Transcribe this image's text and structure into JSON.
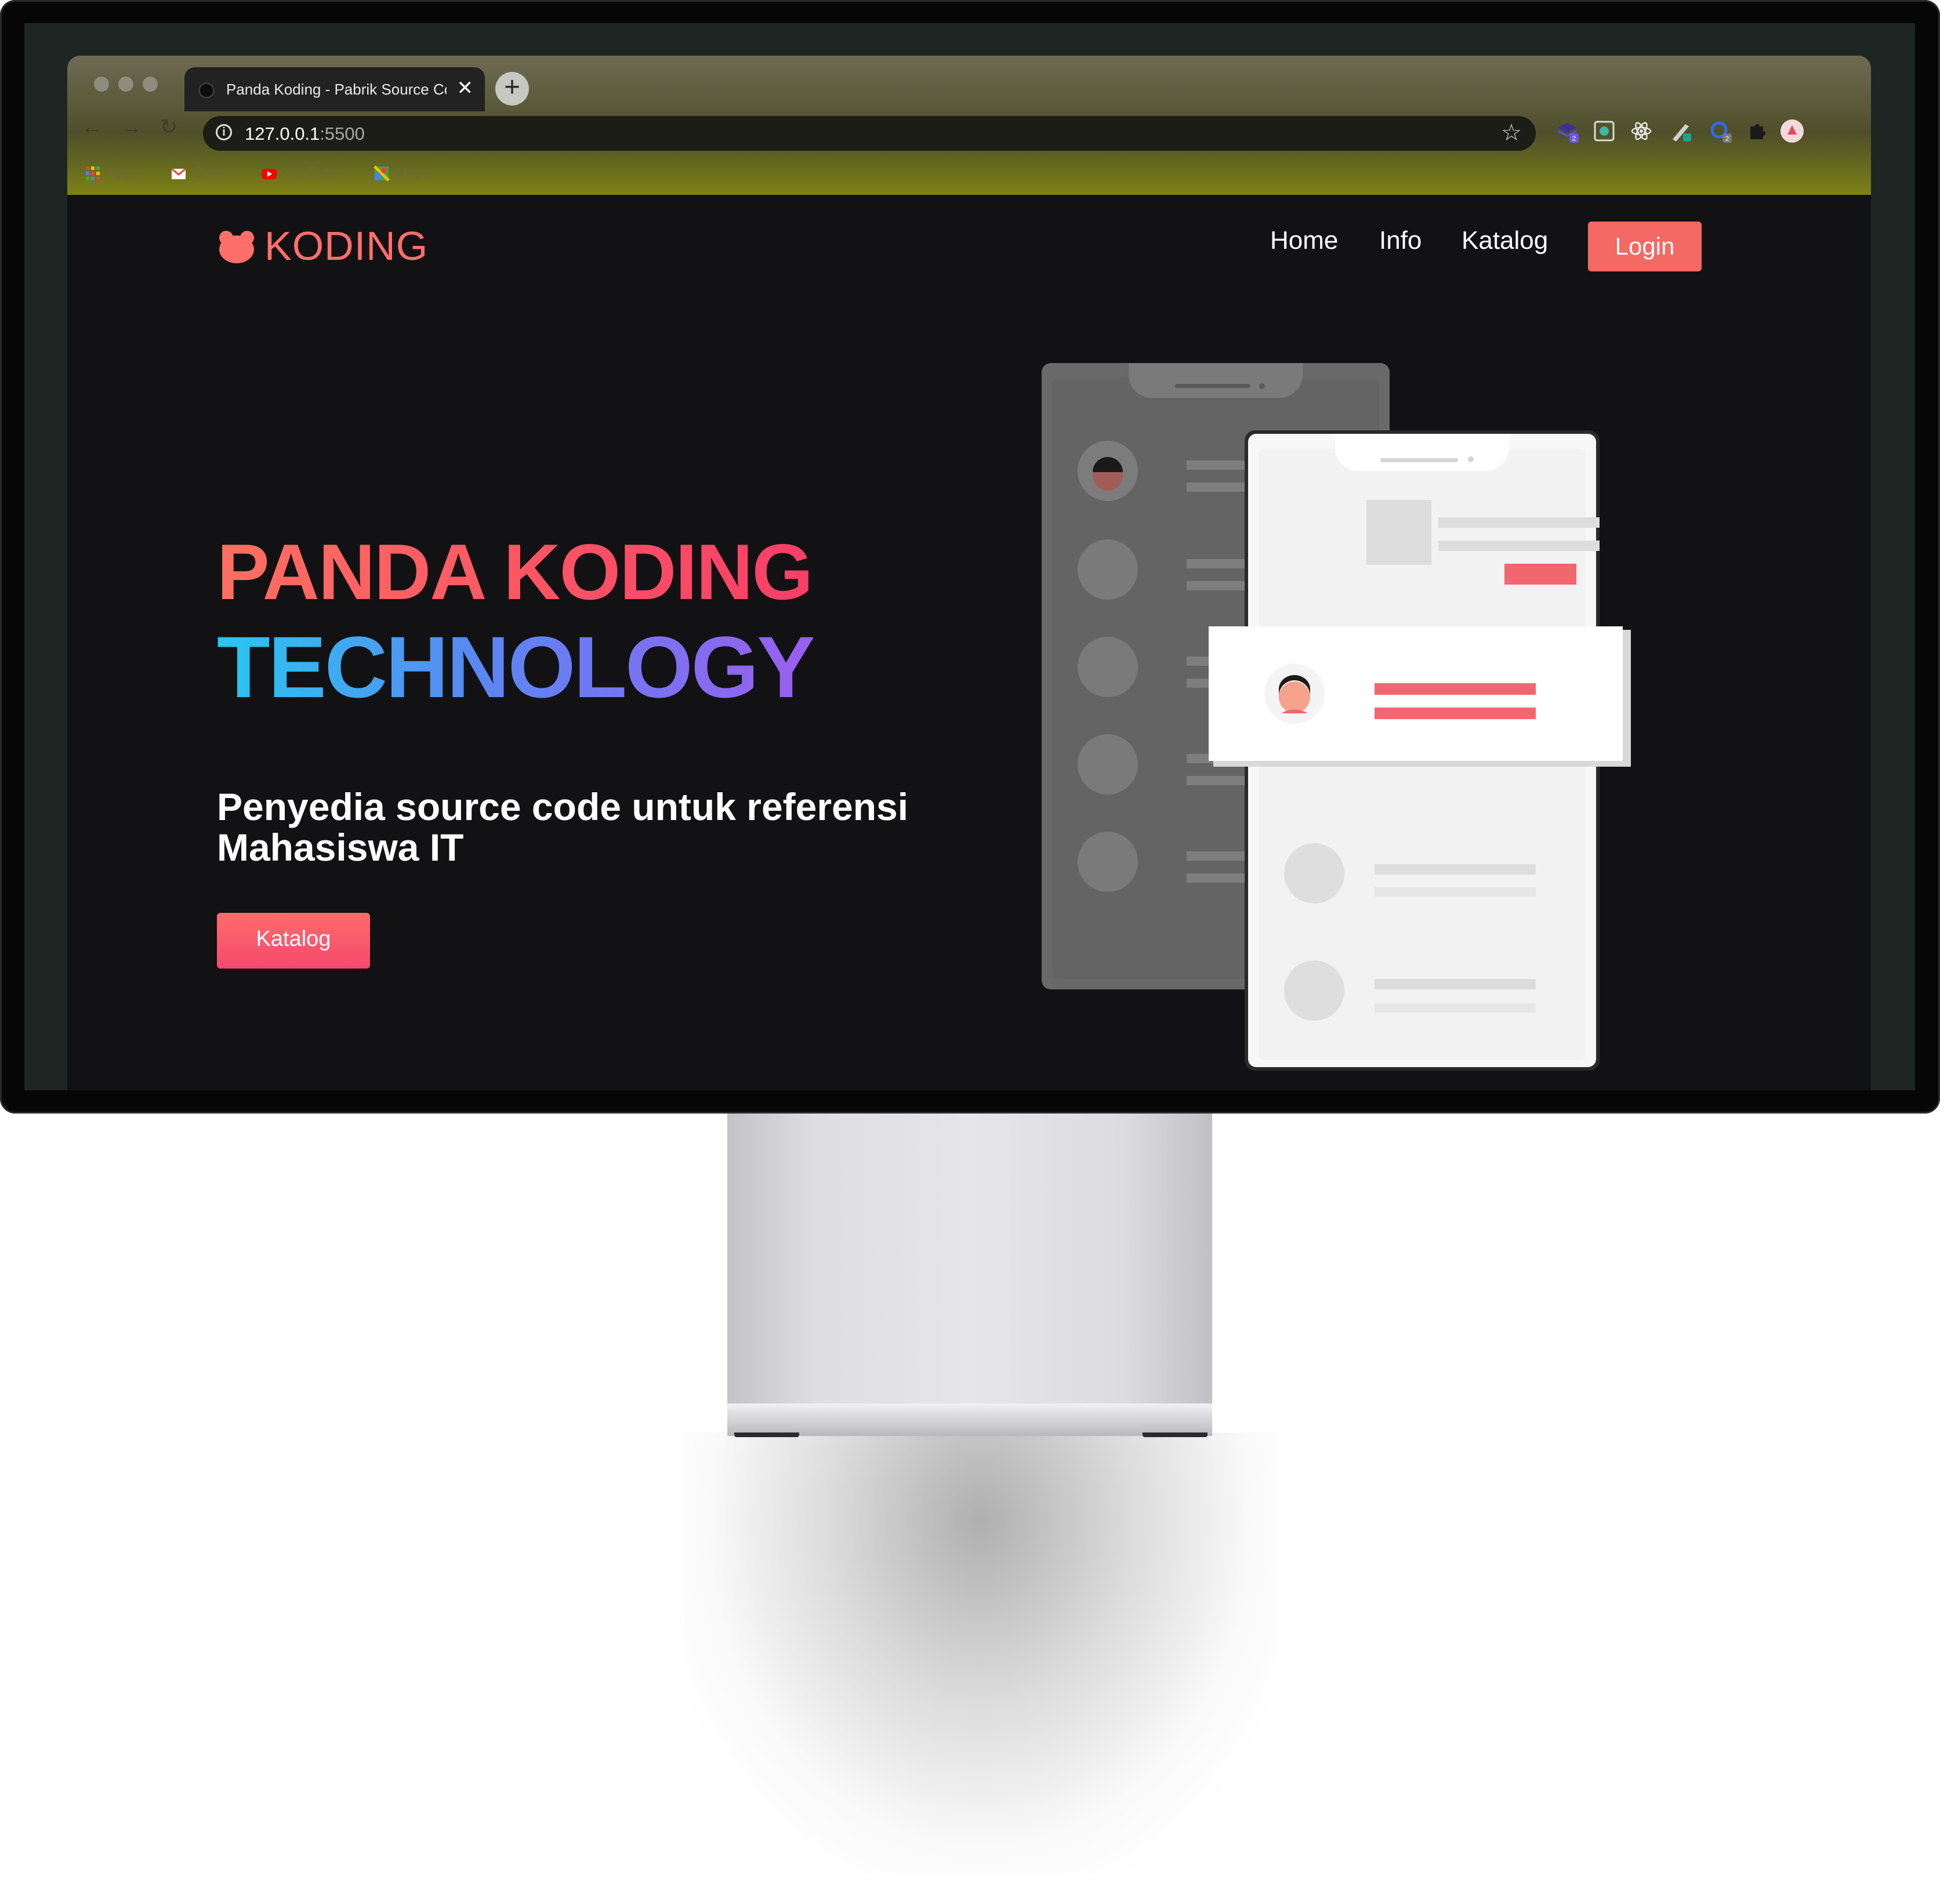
{
  "browser": {
    "tab_title": "Panda Koding - Pabrik Source Code",
    "url_host": "127.0.0.1",
    "url_port": ":5500",
    "new_tab_label": "+",
    "close_label": "✕",
    "bookmarks": [
      {
        "label": "Apps",
        "icon": "apps-grid-icon"
      },
      {
        "label": "Gmail",
        "icon": "gmail-icon"
      },
      {
        "label": "YouTube",
        "icon": "youtube-icon"
      },
      {
        "label": "Maps",
        "icon": "maps-icon"
      }
    ],
    "extension_badges": [
      "2",
      "2"
    ]
  },
  "site": {
    "logo_text": "KODING",
    "nav": {
      "home": "Home",
      "info": "Info",
      "katalog": "Katalog",
      "login": "Login"
    },
    "hero": {
      "line1": "PANDA KODING",
      "line2": "TECHNOLOGY",
      "subtitle": "Penyedia source code untuk referensi Mahasiswa IT",
      "cta": "Katalog"
    }
  },
  "colors": {
    "accent": "#f46963",
    "hero_line1_gradient": [
      "#ff6f61",
      "#f83e68"
    ],
    "hero_line2_gradient": [
      "#28c8f0",
      "#9a5ef0"
    ],
    "page_background": "#121214"
  }
}
